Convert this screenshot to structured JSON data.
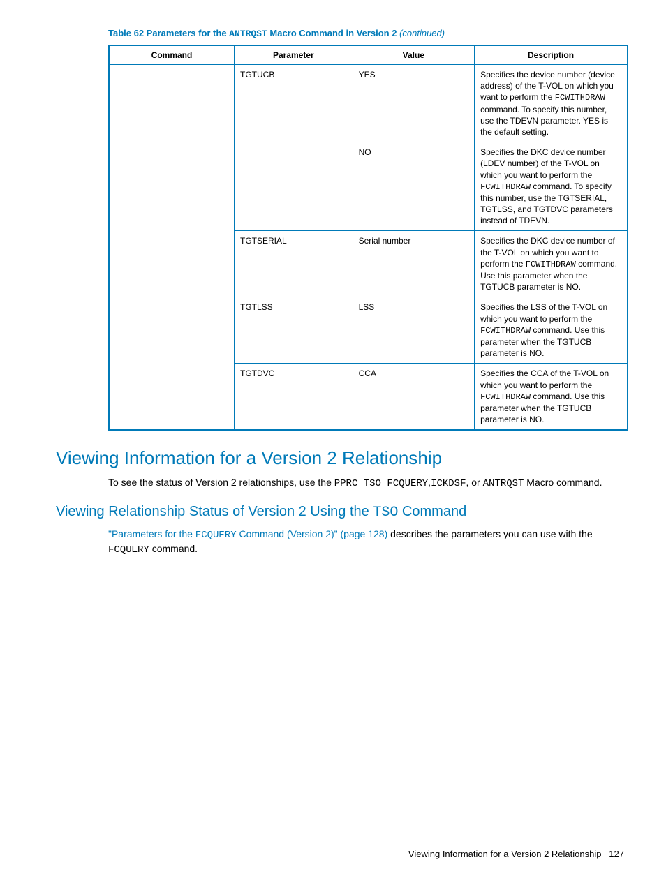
{
  "table": {
    "caption_prefix": "Table 62 Parameters for the ",
    "caption_code": "ANTRQST",
    "caption_suffix": " Macro Command in Version 2 ",
    "caption_cont": "(continued)",
    "headers": {
      "command": "Command",
      "parameter": "Parameter",
      "value": "Value",
      "description": "Description"
    },
    "rows": [
      {
        "parameter": "TGTUCB",
        "value": "YES",
        "desc_pre": "Specifies the device number (device address) of the T-VOL on which you want to perform the ",
        "desc_code": "FCWITHDRAW",
        "desc_post": " command. To specify this number, use the TDEVN parameter. YES is the default setting."
      },
      {
        "parameter": "",
        "value": "NO",
        "desc_pre": "Specifies the DKC device number (LDEV number) of the T-VOL on which you want to perform the ",
        "desc_code": "FCWITHDRAW",
        "desc_post": " command. To specify this number, use the TGTSERIAL, TGTLSS, and TGTDVC parameters instead of TDEVN."
      },
      {
        "parameter": "TGTSERIAL",
        "value": "Serial number",
        "desc_pre": "Specifies the DKC device number of the T-VOL on which you want to perform the ",
        "desc_code": "FCWITHDRAW",
        "desc_post": " command. Use this parameter when the TGTUCB parameter is NO."
      },
      {
        "parameter": "TGTLSS",
        "value": "LSS",
        "desc_pre": "Specifies the LSS of the T-VOL on which you want to perform the ",
        "desc_code": "FCWITHDRAW",
        "desc_post": " command. Use this parameter when the TGTUCB parameter is NO."
      },
      {
        "parameter": "TGTDVC",
        "value": "CCA",
        "desc_pre": "Specifies the CCA of the T-VOL on which you want to perform the ",
        "desc_code": "FCWITHDRAW",
        "desc_post": " command. Use this parameter when the TGTUCB parameter is NO."
      }
    ]
  },
  "heading1": "Viewing Information for a Version 2 Relationship",
  "para1_pre": "To see the status of Version 2 relationships, use the ",
  "para1_code1": "PPRC TSO FCQUERY",
  "para1_mid1": ",",
  "para1_code2": "ICKDSF",
  "para1_mid2": ", or ",
  "para1_code3": "ANTRQST",
  "para1_post": " Macro command.",
  "heading2_pre": "Viewing Relationship Status of Version 2 Using the ",
  "heading2_code": "TSO",
  "heading2_post": " Command",
  "para2_link_pre": "\"Parameters for the ",
  "para2_link_code": "FCQUERY",
  "para2_link_post": " Command (Version 2)\" (page 128)",
  "para2_after": " describes the parameters you can use with the ",
  "para2_code": "FCQUERY",
  "para2_tail": " command.",
  "footer_text": "Viewing Information for a Version 2 Relationship",
  "footer_page": "127"
}
